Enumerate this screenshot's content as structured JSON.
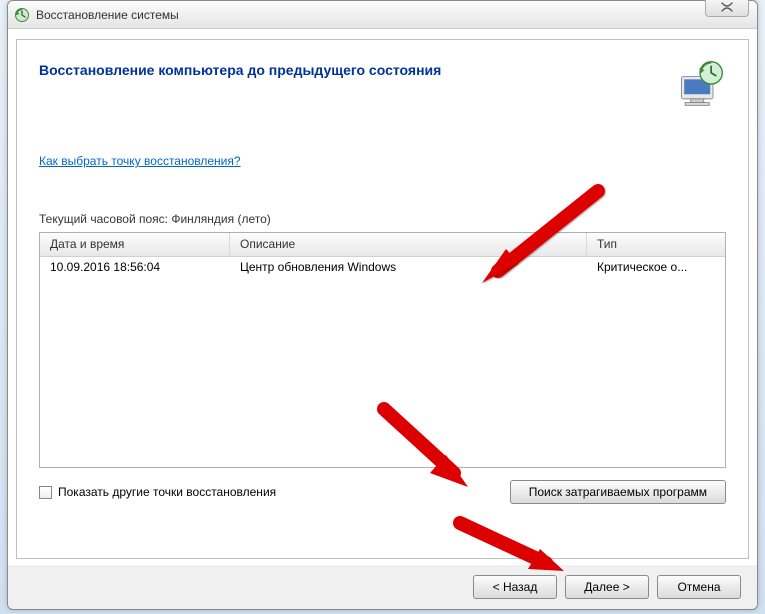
{
  "window": {
    "title": "Восстановление системы",
    "close_symbol": "✕"
  },
  "main": {
    "heading": "Восстановление компьютера до предыдущего состояния",
    "help_link": "Как выбрать точку восстановления?",
    "timezone_label": "Текущий часовой пояс: Финляндия (лето)"
  },
  "table": {
    "headers": {
      "date": "Дата и время",
      "desc": "Описание",
      "type": "Тип"
    },
    "rows": [
      {
        "date": "10.09.2016 18:56:04",
        "desc": "Центр обновления Windows",
        "type": "Критическое о..."
      }
    ]
  },
  "controls": {
    "show_more_label": "Показать другие точки восстановления",
    "scan_button": "Поиск затрагиваемых программ"
  },
  "footer": {
    "back": "< Назад",
    "next": "Далее >",
    "cancel": "Отмена"
  }
}
